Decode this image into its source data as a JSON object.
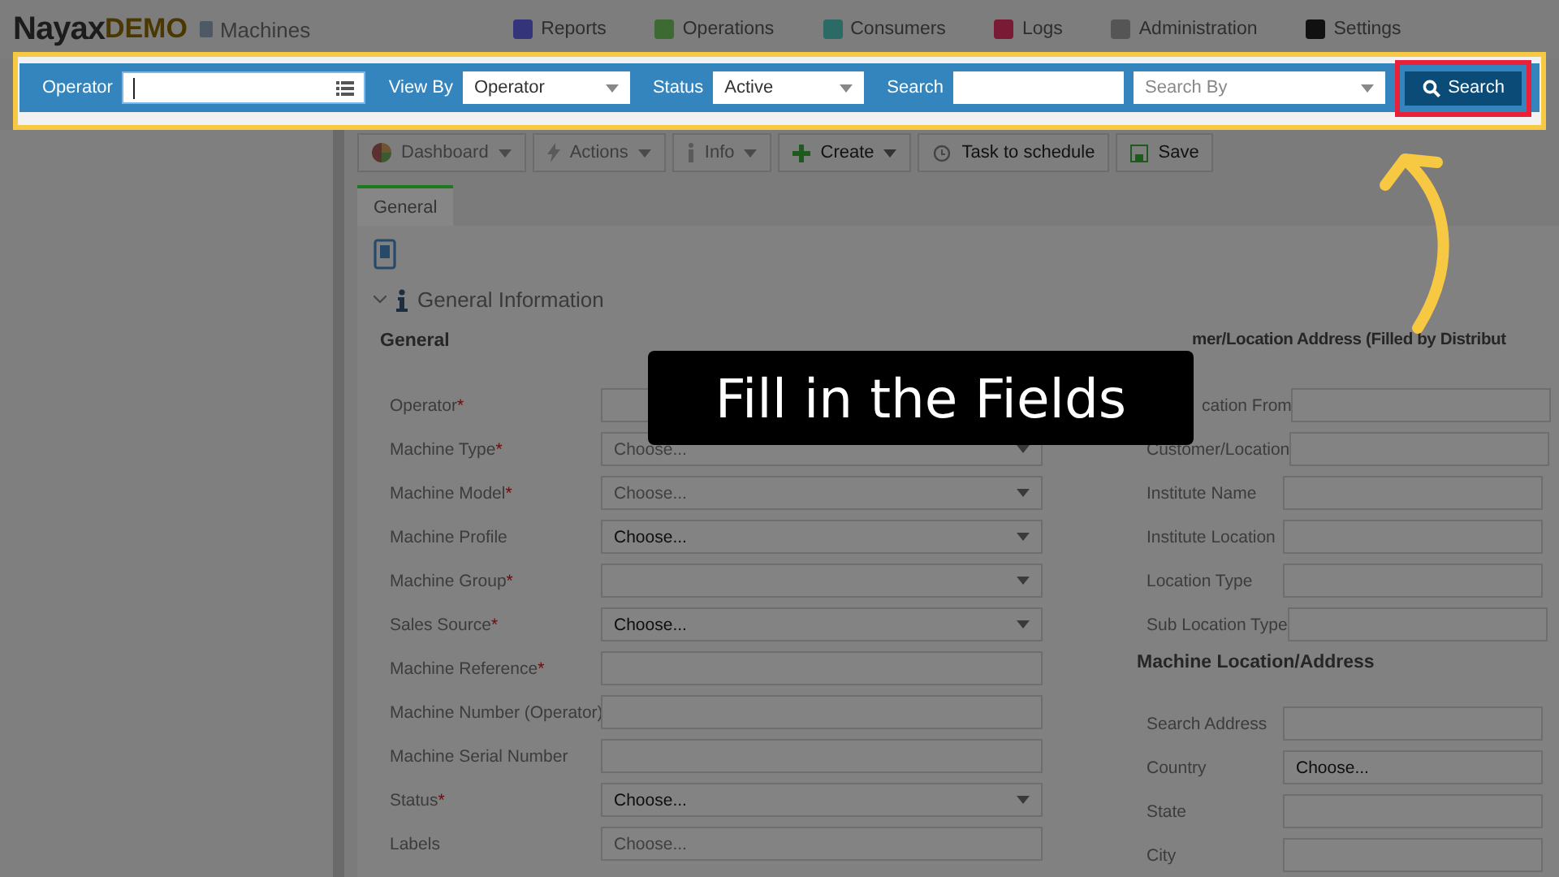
{
  "header": {
    "logo": "Nayax",
    "logo_suffix": "DEMO",
    "page": "Machines",
    "nav": [
      {
        "label": "Reports",
        "color": "#34347a"
      },
      {
        "label": "Operations",
        "color": "#3d6a32"
      },
      {
        "label": "Consumers",
        "color": "#2c6a66"
      },
      {
        "label": "Logs",
        "color": "#7a1a34"
      },
      {
        "label": "Administration",
        "color": "#555555"
      },
      {
        "label": "Settings",
        "color": "#111111"
      }
    ]
  },
  "filter_bar": {
    "fields": [
      {
        "kind": "list-input",
        "label": "Operator",
        "focused": true
      },
      {
        "kind": "select",
        "label": "View By",
        "value": "Operator"
      },
      {
        "kind": "select",
        "label": "Status",
        "value": "Active"
      },
      {
        "kind": "input",
        "label": "Search"
      },
      {
        "kind": "select",
        "placeholder": "Search By"
      }
    ],
    "button": "Search"
  },
  "toolbar": [
    {
      "label": "Dashboard",
      "dropdown": true,
      "disabled": true
    },
    {
      "label": "Actions",
      "dropdown": true,
      "disabled": true
    },
    {
      "label": "Info",
      "dropdown": true,
      "disabled": true
    },
    {
      "label": "Create",
      "dropdown": true,
      "disabled": false
    },
    {
      "label": "Task to schedule",
      "dropdown": false,
      "disabled": false
    },
    {
      "label": "Save",
      "dropdown": false,
      "disabled": false
    }
  ],
  "tabs": [
    {
      "label": "General",
      "selected": true
    }
  ],
  "section": {
    "title": "General Information",
    "expanded": true
  },
  "left_group": {
    "title": "General",
    "rows": [
      {
        "label": "Operator",
        "marker": "*",
        "kind": "text"
      },
      {
        "label": "Machine Type",
        "marker": "*",
        "kind": "select",
        "placeholder": "Choose..."
      },
      {
        "label": "Machine Model",
        "marker": "*",
        "kind": "select",
        "placeholder": "Choose..."
      },
      {
        "label": "Machine Profile",
        "kind": "select",
        "value": "Choose..."
      },
      {
        "label": "Machine Group",
        "marker": "*",
        "kind": "select"
      },
      {
        "label": "Sales Source",
        "marker": "*",
        "kind": "select",
        "value": "Choose..."
      },
      {
        "label": "Machine Reference",
        "marker": "*",
        "kind": "text"
      },
      {
        "label": "Machine Number (Operator)",
        "kind": "text"
      },
      {
        "label": "Machine Serial Number",
        "kind": "text"
      },
      {
        "label": "Status",
        "marker": "*",
        "kind": "select",
        "value": "Choose..."
      },
      {
        "label": "Labels",
        "kind": "text",
        "placeholder": "Choose..."
      }
    ]
  },
  "right_groups": [
    {
      "title": "mer/Location Address (Filled by Distribut",
      "rows": [
        {
          "label": "cation From"
        },
        {
          "label": "Customer/Location"
        },
        {
          "label": "Institute Name"
        },
        {
          "label": "Institute Location"
        },
        {
          "label": "Location Type"
        },
        {
          "label": "Sub Location Type"
        }
      ]
    },
    {
      "title": "Machine Location/Address",
      "rows": [
        {
          "label": "Search Address"
        },
        {
          "label": "Country",
          "value": "Choose..."
        },
        {
          "label": "State"
        },
        {
          "label": "City"
        }
      ]
    }
  ],
  "caption": "Fill in the Fields"
}
